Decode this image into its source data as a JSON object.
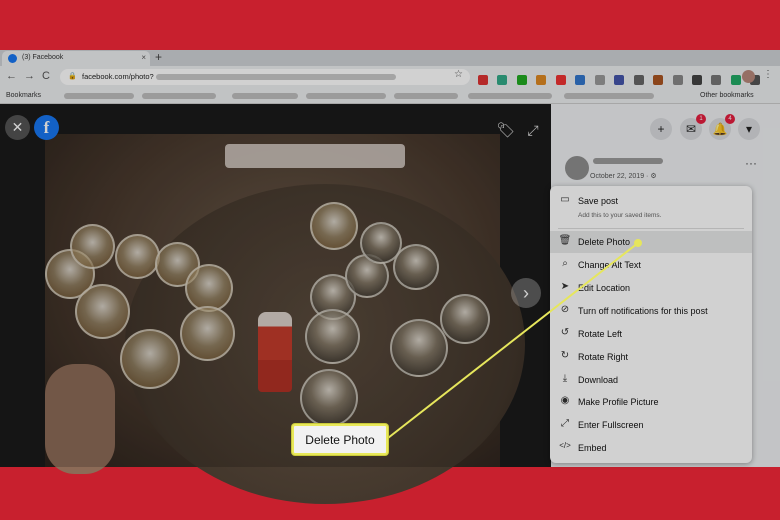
{
  "browser": {
    "tab_title": "(3) Facebook",
    "tab_close": "×",
    "new_tab": "+",
    "url": "facebook.com/photo?",
    "nav": {
      "back": "←",
      "forward": "→",
      "reload": "C"
    },
    "star": "☆",
    "menu": "⋮",
    "bookmarks_label": "Bookmarks",
    "other_bookmarks": "Other bookmarks"
  },
  "viewer": {
    "close": "✕",
    "logo": "f",
    "tag": "🏷",
    "expand": "⤢",
    "next": "›"
  },
  "header": {
    "add": "+",
    "messenger_icon": "✉",
    "messenger_count": "1",
    "notif_icon": "🔔",
    "notif_count": "4",
    "account": "▾"
  },
  "post": {
    "date": "October 22, 2019 · ⚙",
    "more": "···"
  },
  "menu": {
    "items": [
      {
        "icon": "▭",
        "label": "Save post",
        "sub": "Add this to your saved items."
      },
      {
        "icon": "🗑",
        "label": "Delete Photo"
      },
      {
        "icon": "⌕",
        "label": "Change Alt Text"
      },
      {
        "icon": "➤",
        "label": "Edit Location"
      },
      {
        "icon": "⊘",
        "label": "Turn off notifications for this post"
      },
      {
        "icon": "↺",
        "label": "Rotate Left"
      },
      {
        "icon": "↻",
        "label": "Rotate Right"
      },
      {
        "icon": "⤓",
        "label": "Download"
      },
      {
        "icon": "◉",
        "label": "Make Profile Picture"
      },
      {
        "icon": "⤢",
        "label": "Enter Fullscreen"
      },
      {
        "icon": "</>",
        "label": "Embed"
      }
    ]
  },
  "callout": {
    "label": "Delete Photo"
  },
  "colors": {
    "frame": "#c8202e",
    "callout_border": "#e8e85a",
    "leader": "#e6e65c",
    "facebook": "#1877f2"
  }
}
